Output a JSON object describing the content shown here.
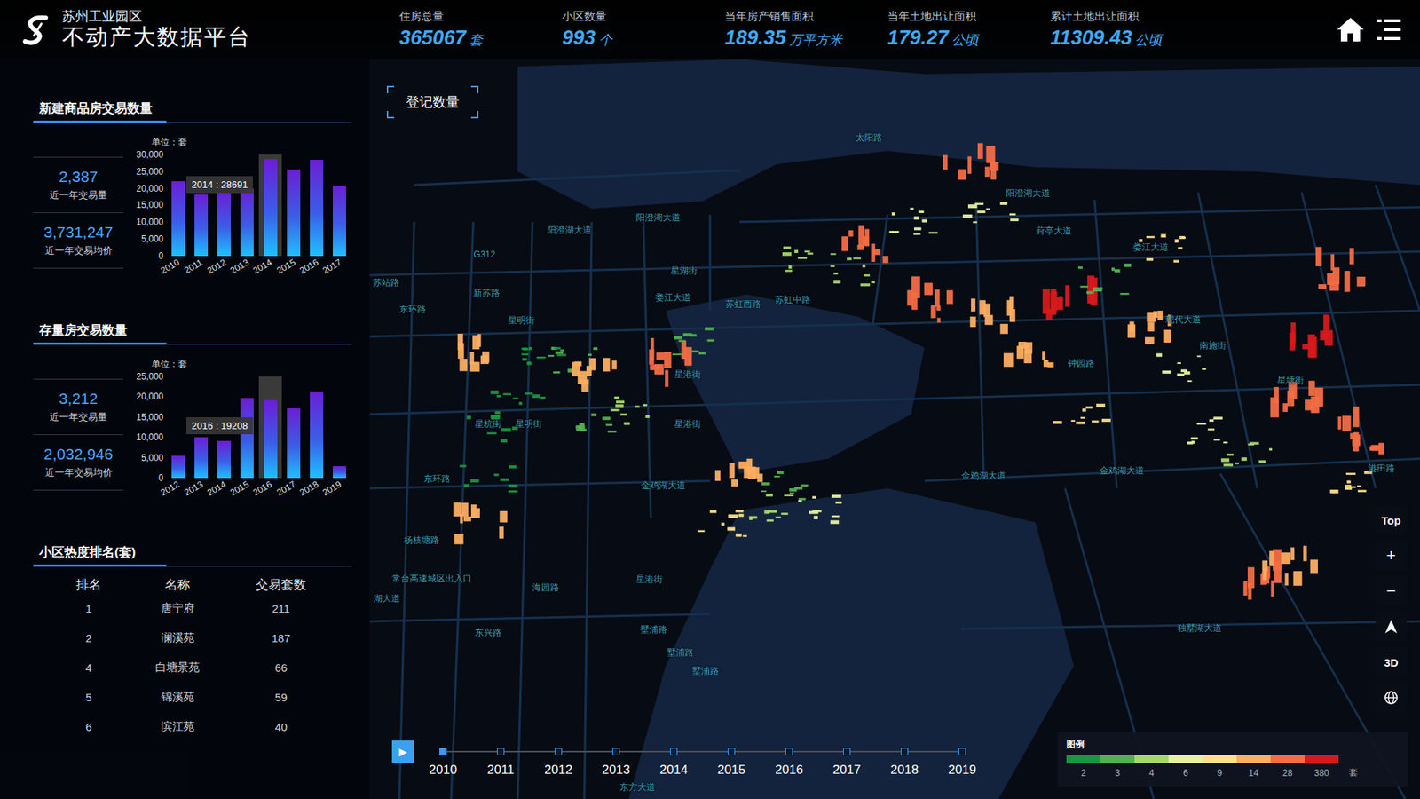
{
  "header": {
    "org": "苏州工业园区",
    "title": "不动产大数据平台",
    "stats": [
      {
        "label": "住房总量",
        "value": "365067",
        "unit": "套"
      },
      {
        "label": "小区数量",
        "value": "993",
        "unit": "个"
      },
      {
        "label": "当年房产销售面积",
        "value": "189.35",
        "unit": "万平方米"
      },
      {
        "label": "当年土地出让面积",
        "value": "179.27",
        "unit": "公顷"
      },
      {
        "label": "累计土地出让面积",
        "value": "11309.43",
        "unit": "公顷"
      }
    ]
  },
  "panels": [
    {
      "title": "新建商品房交易数量",
      "kpis": [
        {
          "value": "2,387",
          "label": "近一年交易量"
        },
        {
          "value": "3,731,247",
          "label": "近一年交易均价"
        }
      ],
      "chart": {
        "unit": "单位：套",
        "max": 30000,
        "ticks": [
          "30,000",
          "25,000",
          "20,000",
          "15,000",
          "10,000",
          "5,000",
          "0"
        ],
        "tooltip": "2014 : 28691",
        "bars": [
          {
            "label": "2010",
            "value": 22200,
            "selected": false
          },
          {
            "label": "2011",
            "value": 18100,
            "selected": false
          },
          {
            "label": "2012",
            "value": 18800,
            "selected": false
          },
          {
            "label": "2013",
            "value": 20000,
            "selected": false
          },
          {
            "label": "2014",
            "value": 28691,
            "selected": true
          },
          {
            "label": "2015",
            "value": 25700,
            "selected": false
          },
          {
            "label": "2016",
            "value": 28400,
            "selected": false
          },
          {
            "label": "2017",
            "value": 20800,
            "selected": false
          }
        ]
      }
    },
    {
      "title": "存量房交易数量",
      "kpis": [
        {
          "value": "3,212",
          "label": "近一年交易量"
        },
        {
          "value": "2,032,946",
          "label": "近一年交易均价"
        }
      ],
      "chart": {
        "unit": "单位：套",
        "max": 25000,
        "ticks": [
          "25,000",
          "20,000",
          "15,000",
          "10,000",
          "5,000",
          "0"
        ],
        "tooltip": "2016 : 19208",
        "bars": [
          {
            "label": "2012",
            "value": 5400,
            "selected": false
          },
          {
            "label": "2013",
            "value": 10100,
            "selected": false
          },
          {
            "label": "2014",
            "value": 9200,
            "selected": false
          },
          {
            "label": "2015",
            "value": 19800,
            "selected": false
          },
          {
            "label": "2016",
            "value": 19208,
            "selected": true
          },
          {
            "label": "2017",
            "value": 17100,
            "selected": false
          },
          {
            "label": "2018",
            "value": 21400,
            "selected": false
          },
          {
            "label": "2019",
            "value": 2900,
            "selected": false
          }
        ]
      }
    }
  ],
  "ranking": {
    "title": "小区热度排名(套)",
    "columns": [
      "排名",
      "名称",
      "交易套数"
    ],
    "rows": [
      [
        "1",
        "唐宁府",
        "211"
      ],
      [
        "2",
        "澜溪苑",
        "187"
      ],
      [
        "4",
        "白塘景苑",
        "66"
      ],
      [
        "5",
        "锦溪苑",
        "59"
      ],
      [
        "6",
        "滨江苑",
        "40"
      ]
    ]
  },
  "map": {
    "title": "登记数量",
    "roads": [
      "阳澄湖大道",
      "阳澄湖大道",
      "阳澄湖大道",
      "星湖街",
      "娄江大道",
      "苏虹西路",
      "苏虹中路",
      "现代大道",
      "星港街",
      "星港街",
      "星明街",
      "星明街",
      "东环路",
      "东环路",
      "金鸡湖大道",
      "金鸡湖大道",
      "金鸡湖大道",
      "独墅湖大道",
      "常台高速城区出入口",
      "东兴路",
      "墅浦路",
      "墅浦路",
      "墅浦路",
      "东方大道",
      "港田路",
      "星塘街",
      "钟园路",
      "南施街",
      "苏站路",
      "新苏路",
      "星杭街",
      "杨枝塘路",
      "海园路",
      "星港街",
      "G312",
      "娄江大道",
      "葑亭大道",
      "太阳路",
      "湖大道"
    ],
    "clusters": [
      {
        "count": 28
      },
      {
        "count": 6
      },
      {
        "count": 4
      },
      {
        "count": 28
      },
      {
        "count": 28
      },
      {
        "count": 14
      },
      {
        "count": 380
      },
      {
        "count": 14
      },
      {
        "count": 380
      },
      {
        "count": 28
      },
      {
        "count": 9
      },
      {
        "count": 6
      },
      {
        "count": 28
      },
      {
        "count": 28
      },
      {
        "count": 9
      },
      {
        "count": 3
      },
      {
        "count": 14
      },
      {
        "count": 28
      },
      {
        "count": 14
      },
      {
        "count": 3
      },
      {
        "count": 6
      },
      {
        "count": 9
      },
      {
        "count": 14
      },
      {
        "count": 14
      },
      {
        "count": 2
      },
      {
        "count": 4
      },
      {
        "count": 3
      },
      {
        "count": 6
      },
      {
        "count": 9
      },
      {
        "count": 28
      },
      {
        "count": 14
      },
      {
        "count": 2
      },
      {
        "count": 14
      },
      {
        "count": 2
      },
      {
        "count": 3
      },
      {
        "count": 6
      },
      {
        "count": 4
      },
      {
        "count": 2
      },
      {
        "count": 4
      },
      {
        "count": 3
      },
      {
        "count": 4
      }
    ]
  },
  "controls": {
    "top": "Top",
    "zoom_in": "+",
    "zoom_out": "−",
    "view": "3D"
  },
  "timeline": {
    "play": "▶",
    "years": [
      {
        "label": "2010",
        "selected": true
      },
      {
        "label": "2011",
        "selected": false
      },
      {
        "label": "2012",
        "selected": false
      },
      {
        "label": "2013",
        "selected": false
      },
      {
        "label": "2014",
        "selected": false
      },
      {
        "label": "2015",
        "selected": false
      },
      {
        "label": "2016",
        "selected": false
      },
      {
        "label": "2017",
        "selected": false
      },
      {
        "label": "2018",
        "selected": false
      },
      {
        "label": "2019",
        "selected": false
      }
    ]
  },
  "legend": {
    "title": "图例",
    "unit": "套",
    "items": [
      {
        "label": "2",
        "color": "#1a9641"
      },
      {
        "label": "3",
        "color": "#52b151"
      },
      {
        "label": "4",
        "color": "#a6d96a"
      },
      {
        "label": "6",
        "color": "#e6f0a0"
      },
      {
        "label": "9",
        "color": "#fee08b"
      },
      {
        "label": "14",
        "color": "#fdae61"
      },
      {
        "label": "28",
        "color": "#f46d43"
      },
      {
        "label": "380",
        "color": "#d7191c"
      }
    ]
  }
}
